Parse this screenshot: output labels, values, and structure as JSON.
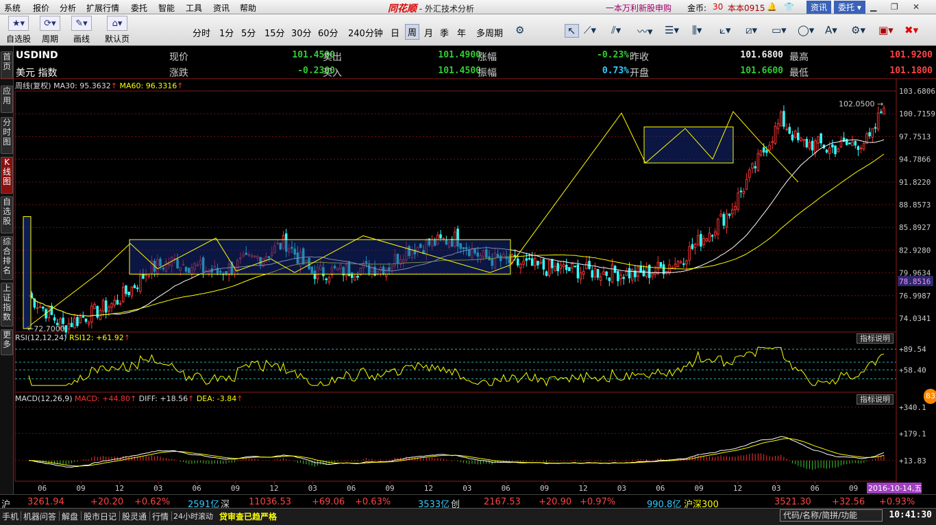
{
  "menu": [
    "系统",
    "报价",
    "分析",
    "扩展行情",
    "委托",
    "智能",
    "工具",
    "资讯",
    "帮助"
  ],
  "app": {
    "logo": "同花顺",
    "title": "- 外汇技术分析"
  },
  "header_right": {
    "promo": "一本万利新股申购",
    "gold_label": "金币:",
    "gold_value": "30",
    "user": "本本0915",
    "news_btn": "资讯",
    "trade_btn": "委托"
  },
  "toolbar": {
    "buttons": [
      {
        "label": "自选股",
        "icon": "star-icon"
      },
      {
        "label": "周期",
        "icon": "cycle-icon"
      },
      {
        "label": "画线",
        "icon": "pen-icon"
      },
      {
        "label": "默认页",
        "icon": "home-icon"
      }
    ],
    "periods": [
      "分时",
      "1分",
      "5分",
      "15分",
      "30分",
      "60分",
      "240分钟",
      "日",
      "周",
      "月",
      "季",
      "年",
      "多周期"
    ],
    "selected_period": "周"
  },
  "side_tabs": [
    "首页",
    "应用",
    "分时图",
    "K线图",
    "自选股",
    "综合排名",
    "上证指数",
    "更多"
  ],
  "active_side_tab": "K线图",
  "quote": {
    "symbol": "USDIND",
    "name": "美元 指数",
    "rows": [
      [
        {
          "l": "现价",
          "v": "101.4500",
          "c": "#3c3"
        },
        {
          "l": "卖出",
          "v": "101.4900",
          "c": "#3c3"
        },
        {
          "l": "涨幅",
          "v": "-0.23%",
          "c": "#3c3"
        },
        {
          "l": "昨收",
          "v": "101.6800",
          "c": "#eee"
        },
        {
          "l": "最高",
          "v": "101.9200",
          "c": "#f44"
        }
      ],
      [
        {
          "l": "涨跌",
          "v": "-0.2300",
          "c": "#3c3"
        },
        {
          "l": "买入",
          "v": "101.4500",
          "c": "#3c3"
        },
        {
          "l": "振幅",
          "v": "0.73%",
          "c": "#3cf"
        },
        {
          "l": "开盘",
          "v": "101.6600",
          "c": "#3c3"
        },
        {
          "l": "最低",
          "v": "101.1800",
          "c": "#f44"
        }
      ]
    ]
  },
  "legend": {
    "period": "周线(复权)",
    "ma30": "MA30: 95.3632",
    "ma60": "MA60: 96.3316",
    "rsi": "RSI(12,12,24)",
    "rsi12": "RSI12: +61.92",
    "macd": "MACD(12,26,9)",
    "macd_v": "MACD: +44.80",
    "diff": "DIFF: +18.56",
    "dea": "DEA: -3.84",
    "help": "指标说明",
    "badge": "83"
  },
  "annotations": {
    "high": "102.0500",
    "low": "72.7000"
  },
  "price_scale": [
    "103.6806",
    "100.7159",
    "97.7513",
    "94.7866",
    "91.8220",
    "88.8573",
    "85.8927",
    "82.9280",
    "79.9634",
    "76.9987",
    "74.0341"
  ],
  "last_price_tag": "78.8516",
  "rsi_scale": [
    "+89.54",
    "+58.40"
  ],
  "macd_scale": [
    "+340.1",
    "+179.1",
    "+13.83"
  ],
  "time_axis": [
    "06",
    "09",
    "12",
    "03",
    "06",
    "09",
    "12",
    "03",
    "06",
    "09",
    "12",
    "03",
    "06",
    "09",
    "12",
    "03",
    "06",
    "09",
    "12",
    "03",
    "06",
    "09"
  ],
  "date_label": "2016-10-14,五",
  "status": [
    {
      "t": "沪",
      "c": "#ddd"
    },
    {
      "t": "3261.94",
      "c": "#f44"
    },
    {
      "t": "+20.20",
      "c": "#f44"
    },
    {
      "t": "+0.62%",
      "c": "#f44"
    },
    {
      "t": "2591亿",
      "c": "#3cf"
    },
    {
      "t": "深",
      "c": "#ddd"
    },
    {
      "t": "11036.53",
      "c": "#f44"
    },
    {
      "t": "+69.06",
      "c": "#f44"
    },
    {
      "t": "+0.63%",
      "c": "#f44"
    },
    {
      "t": "3533亿",
      "c": "#3cf"
    },
    {
      "t": "创",
      "c": "#ddd"
    },
    {
      "t": "2167.53",
      "c": "#f44"
    },
    {
      "t": "+20.90",
      "c": "#f44"
    },
    {
      "t": "+0.97%",
      "c": "#f44"
    },
    {
      "t": "990.8亿",
      "c": "#3cf"
    },
    {
      "t": "沪深300",
      "c": "#ff0"
    },
    {
      "t": "3521.30",
      "c": "#f44"
    },
    {
      "t": "+32.56",
      "c": "#f44"
    },
    {
      "t": "+0.93%",
      "c": "#f44"
    }
  ],
  "bottom": {
    "items": [
      "手机",
      "机器问答",
      "解盘",
      "股市日记",
      "股灵通",
      "行情",
      "24小时滚动"
    ],
    "news": "贷审查已趋严格",
    "search_placeholder": "代码/名称/简拼/功能",
    "clock": "10:41:30"
  },
  "chart_data": {
    "type": "candlestick",
    "symbol": "USDIND",
    "period": "weekly",
    "ylim": [
      72.7,
      103.68
    ],
    "start": 77.0,
    "end": 101.45,
    "high": 102.05,
    "low": 72.7,
    "ma": [
      {
        "name": "MA30",
        "value": 95.3632
      },
      {
        "name": "MA60",
        "value": 96.3316
      }
    ],
    "rsi_last": 61.92,
    "macd_last": 44.8
  }
}
